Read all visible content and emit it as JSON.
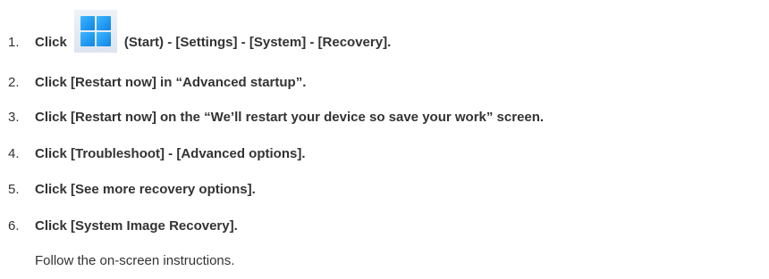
{
  "steps": [
    {
      "number": "1.",
      "before": "Click",
      "after": "(Start) - [Settings] - [System] - [Recovery]."
    },
    {
      "number": "2.",
      "text": "Click [Restart now] in “Advanced startup”."
    },
    {
      "number": "3.",
      "text": "Click [Restart now] on the “We’ll restart your device so save your work” screen."
    },
    {
      "number": "4.",
      "text": "Click [Troubleshoot] - [Advanced options]."
    },
    {
      "number": "5.",
      "text": "Click [See more recovery options]."
    },
    {
      "number": "6.",
      "text": "Click [System Image Recovery]."
    }
  ],
  "note": "Follow the on-screen instructions.",
  "icons": {
    "start": "windows-start-icon"
  },
  "colors": {
    "text": "#333333",
    "icon_blue": "#1a8fea"
  }
}
